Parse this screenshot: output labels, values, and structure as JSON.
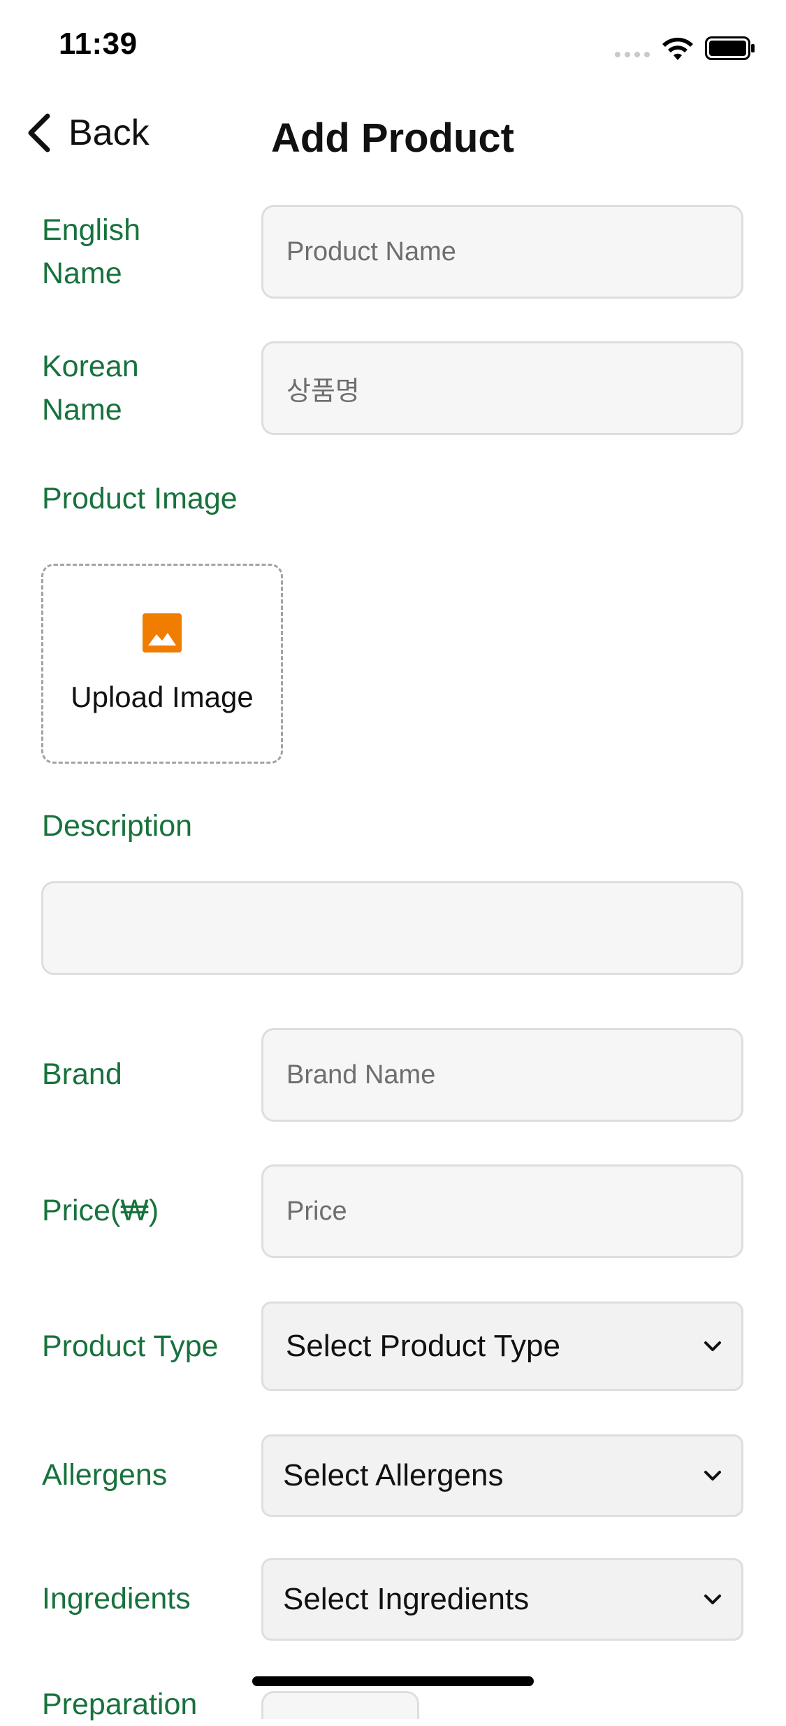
{
  "status_bar": {
    "time": "11:39"
  },
  "nav": {
    "back_label": "Back",
    "title": "Add Product"
  },
  "form": {
    "english_name": {
      "label": "English Name",
      "placeholder": "Product Name"
    },
    "korean_name": {
      "label": "Korean Name",
      "placeholder": "상품명"
    },
    "product_image": {
      "label": "Product Image",
      "upload_label": "Upload Image"
    },
    "description": {
      "label": "Description",
      "value": ""
    },
    "brand": {
      "label": "Brand",
      "placeholder": "Brand Name"
    },
    "price": {
      "label": "Price(₩)",
      "placeholder": "Price"
    },
    "product_type": {
      "label": "Product Type",
      "selected": "Select Product Type"
    },
    "allergens": {
      "label": "Allergens",
      "selected": "Select Allergens"
    },
    "ingredients": {
      "label": "Ingredients",
      "selected": "Select Ingredients"
    },
    "preparation": {
      "label": "Preparation"
    }
  },
  "colors": {
    "label_green": "#17723d",
    "upload_icon_orange": "#f07d00"
  },
  "icons": [
    "chevron-left-icon",
    "wifi-icon",
    "battery-icon",
    "image-icon",
    "chevron-down-icon"
  ]
}
